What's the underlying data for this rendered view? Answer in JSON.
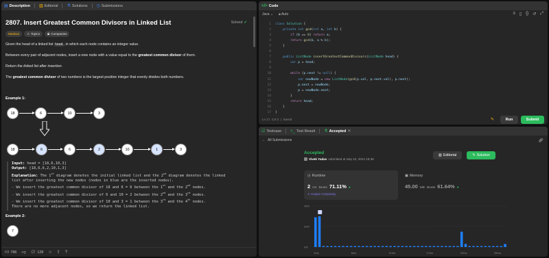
{
  "left": {
    "tabs": [
      {
        "label": "Description",
        "icon": "file-icon"
      },
      {
        "label": "Editorial",
        "icon": "book-icon"
      },
      {
        "label": "Solutions",
        "icon": "flask-icon"
      },
      {
        "label": "Submissions",
        "icon": "clock-icon"
      }
    ],
    "title": "2807. Insert Greatest Common Divisors in Linked List",
    "solved": "Solved",
    "chips": {
      "difficulty": "Medium",
      "topics": "Topics",
      "companies": "Companies"
    },
    "para1": {
      "a": "Given the head of a linked list ",
      "code": "head",
      "b": ", in which each node contains an integer value."
    },
    "para2": {
      "a": "Between every pair of adjacent nodes, insert a new node with a value equal to the ",
      "bold": "greatest common divisor",
      "b": " of them."
    },
    "para3": {
      "a": "Return ",
      "italic": "the linked list after insertion",
      "b": "."
    },
    "para4": {
      "bold": "greatest common divisor",
      "a": "The ",
      "b": " of two numbers is the largest positive integer that evenly divides both numbers."
    },
    "example1_title": "Example 1:",
    "example2_title": "Example 2:",
    "list_top": [
      "18",
      "6",
      "10",
      "3"
    ],
    "list_bottom": [
      "18",
      "6",
      "6",
      "2",
      "10",
      "1",
      "3"
    ],
    "list_ex2": [
      "7"
    ],
    "example": {
      "input_label": "Input:",
      "input": "head = [18,6,10,3]",
      "output_label": "Output:",
      "output": "[18,6,6,2,10,1,3]",
      "expl_label": "Explanation:",
      "expl_1a": "The 1",
      "expl_1b": " diagram denotes the initial linked list and the 2",
      "expl_1c": " diagram denotes the linked",
      "expl_2": "list after inserting the new nodes (nodes in blue are the inserted nodes).",
      "l1a": "- We insert the greatest common divisor of 18 and 6 = 6 between the 1",
      "l1b": " and the 2",
      "l1c": " nodes.",
      "l2a": "- We insert the greatest common divisor of 6 and 10 = 2 between the 2",
      "l2b": " and the 3",
      "l2c": " nodes.",
      "l3a": "- We insert the greatest common divisor of 10 and 3 = 1 between the 3",
      "l3b": " and the 4",
      "l3c": " nodes.",
      "last": "There are no more adjacent nodes, so we return the linked list.",
      "st": "st",
      "nd": "nd",
      "rd": "rd",
      "th": "th"
    },
    "footer": {
      "likes": "786",
      "comments": "128"
    }
  },
  "code": {
    "tab": "Code",
    "language": "Java",
    "autocomplete": "Auto",
    "lines": [
      {
        "n": "1",
        "t": "class Solution {"
      },
      {
        "n": "2",
        "t": "    private int gcd(int a, int b) {"
      },
      {
        "n": "3",
        "t": "        if (b == 0) return a;"
      },
      {
        "n": "4",
        "t": "        return gcd(b, a % b);"
      },
      {
        "n": "5",
        "t": "    }"
      },
      {
        "n": "6",
        "t": ""
      },
      {
        "n": "7",
        "t": "    public ListNode insertGreatestCommonDivisors(ListNode head) {"
      },
      {
        "n": "8",
        "t": "        var p = head;"
      },
      {
        "n": "9",
        "t": ""
      },
      {
        "n": "10",
        "t": "        while (p.next != null) {"
      },
      {
        "n": "11",
        "t": "            var newNode = new ListNode(gcd(p.val, p.next.val), p.next);"
      },
      {
        "n": "12",
        "t": "            p.next = newNode;"
      },
      {
        "n": "13",
        "t": "            p = newNode.next;"
      },
      {
        "n": "14",
        "t": "        }"
      },
      {
        "n": "15",
        "t": "        return head;"
      },
      {
        "n": "16",
        "t": "    }"
      },
      {
        "n": "17",
        "t": "}"
      }
    ],
    "status": "Ln 17, Col 2",
    "saved": "Saved",
    "run": "Run",
    "submit": "Submit"
  },
  "bottom": {
    "tabs": [
      {
        "label": "Testcase"
      },
      {
        "label": "Test Result"
      },
      {
        "label": "Accepted"
      }
    ],
    "all_submissions": "All Submissions",
    "accepted": "Accepted",
    "user": "Vivek Yadav",
    "submitted": "submitted at Sep 10, 2024 18:36",
    "editorial": "Editorial",
    "solution": "Solution",
    "runtime": {
      "label": "Runtime",
      "value": "2",
      "unit": "ms",
      "beats_label": "Beats",
      "beats": "71.11%",
      "analyze": "Analyze Complexity"
    },
    "memory": {
      "label": "Memory",
      "value": "45.00",
      "unit": "MB",
      "beats_label": "Beats",
      "beats": "61.64%"
    }
  },
  "colors": {
    "accent_green": "#2cbb5d",
    "bar_blue": "#1e7fff",
    "medium": "#ffb800"
  },
  "chart_data": {
    "type": "bar",
    "yticks": [
      "40%",
      "20%",
      "0%"
    ],
    "ylim": [
      0,
      40
    ],
    "xticks": [
      "1ms",
      "6ms",
      "11ms",
      "17ms",
      "22ms",
      "28ms"
    ],
    "values": [
      29,
      30,
      1,
      1,
      1,
      1,
      1,
      1,
      1,
      1,
      1,
      1,
      1,
      1,
      1,
      1,
      1,
      1,
      1,
      1,
      1,
      1,
      1,
      1,
      1,
      1,
      1,
      1,
      1,
      1,
      1,
      1,
      1,
      1,
      1,
      1,
      1,
      15,
      3,
      1,
      1,
      1,
      1,
      1,
      1,
      1,
      1,
      1,
      3
    ]
  }
}
